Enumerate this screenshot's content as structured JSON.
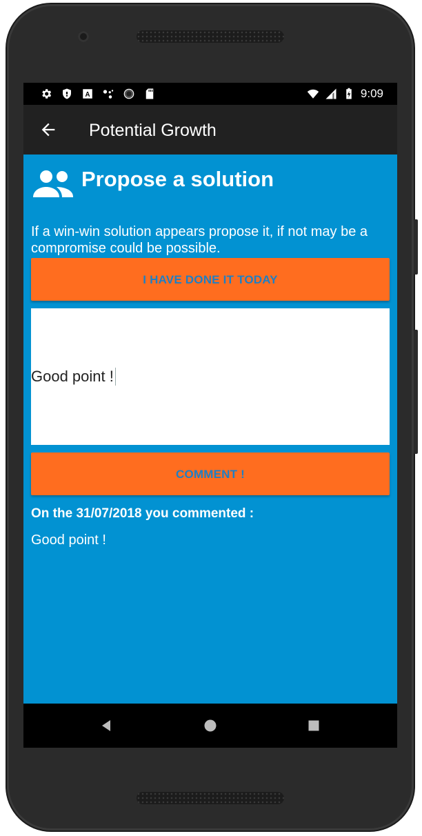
{
  "statusbar": {
    "time": "9:09",
    "left_icons": [
      "settings-icon",
      "shield-icon",
      "a-box-icon",
      "assistant-dots-icon",
      "circle-icon",
      "sd-card-icon"
    ],
    "right_icons": [
      "wifi-icon",
      "signal-icon",
      "battery-charging-icon"
    ]
  },
  "appbar": {
    "title": "Potential Growth",
    "back_icon": "arrow-back-icon"
  },
  "section": {
    "icon": "people-icon",
    "title": "Propose a solution",
    "description": "If a win-win solution appears propose it, if not may be a compromise could be possible."
  },
  "actions": {
    "done_today_label": "I HAVE DONE IT TODAY",
    "comment_label": "COMMENT !"
  },
  "input": {
    "value": "Good point !"
  },
  "comment": {
    "header": "On the 31/07/2018 you commented :",
    "text": "Good point !"
  },
  "navbar": {
    "icons": [
      "nav-back-icon",
      "nav-home-icon",
      "nav-recent-icon"
    ]
  },
  "colors": {
    "primary_blue": "#0292d2",
    "appbar_dark": "#212121",
    "accent_orange": "#ff6d1f",
    "button_text_blue": "#1f7fc4"
  }
}
